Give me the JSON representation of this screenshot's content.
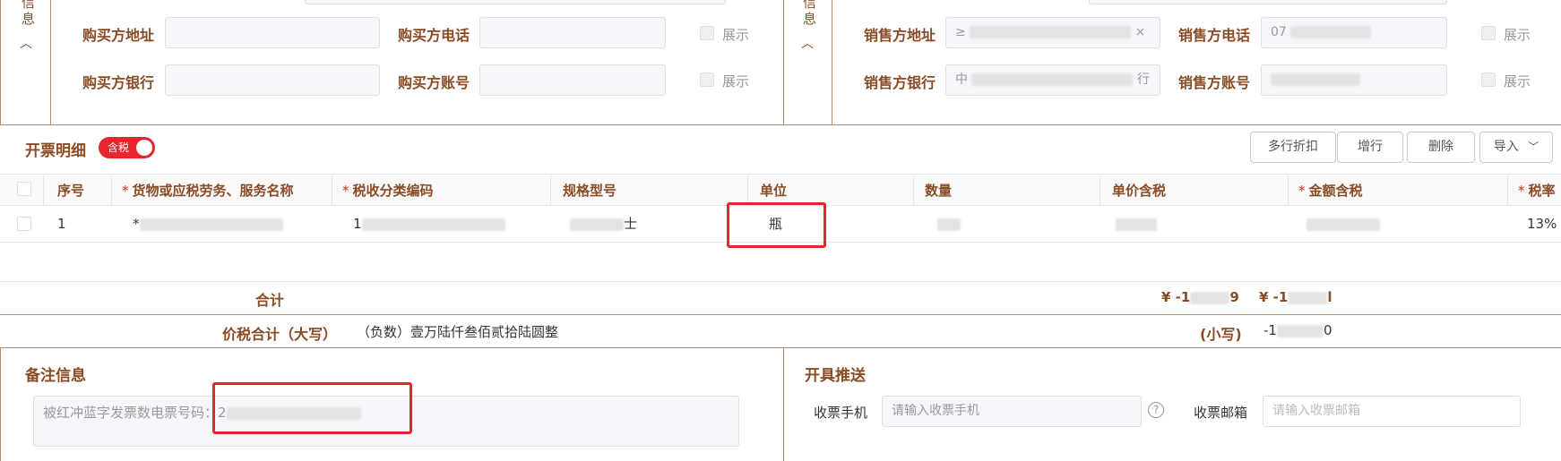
{
  "buyer": {
    "side_label_top": "信",
    "side_label_bottom": "息",
    "address_label": "购买方地址",
    "phone_label": "购买方电话",
    "bank_label": "购买方银行",
    "account_label": "购买方账号",
    "show_label": "展示"
  },
  "seller": {
    "side_label_top": "信",
    "side_label_bottom": "息",
    "address_label": "销售方地址",
    "address_value_prefix": "≥",
    "phone_label": "销售方电话",
    "phone_value_prefix": "07",
    "bank_label": "销售方银行",
    "bank_value_prefix": "中",
    "bank_value_suffix": "行",
    "account_label": "销售方账号",
    "show_label": "展示"
  },
  "details": {
    "title": "开票明细",
    "tax_toggle_label": "含税",
    "buttons": [
      "多行折扣",
      "增行",
      "删除",
      "导入"
    ],
    "columns": [
      "序号",
      "货物或应税劳务、服务名称",
      "税收分类编码",
      "规格型号",
      "单位",
      "数量",
      "单价含税",
      "金额含税",
      "税率"
    ],
    "required_columns": [
      1,
      2,
      7,
      8
    ],
    "row": {
      "seq": "1",
      "name_prefix": "*",
      "code_prefix": "1",
      "spec_suffix": "士",
      "unit": "瓶",
      "tax_rate": "13%"
    }
  },
  "totals": {
    "sum_label": "合计",
    "sum_amount_prefix": "¥ -1",
    "sum_amount_suffix": "9",
    "sum_tax_prefix": "¥ -1",
    "sum_tax_suffix": "l",
    "total_label": "价税合计（大写）",
    "total_words": "（负数）壹万陆仟叁佰贰拾陆圆整",
    "small_label": "(小写)",
    "small_value_prefix": "-1",
    "small_value_suffix": "0"
  },
  "remarks": {
    "title": "备注信息",
    "text_prefix": "被红冲蓝字发票数电票号码：2"
  },
  "push": {
    "title": "开具推送",
    "phone_label": "收票手机",
    "phone_placeholder": "请输入收票手机",
    "email_label": "收票邮箱",
    "email_placeholder": "请输入收票邮箱"
  },
  "colors": {
    "brand": "#8a4b24",
    "accent_red": "#e5262b",
    "border": "#b98a66"
  }
}
